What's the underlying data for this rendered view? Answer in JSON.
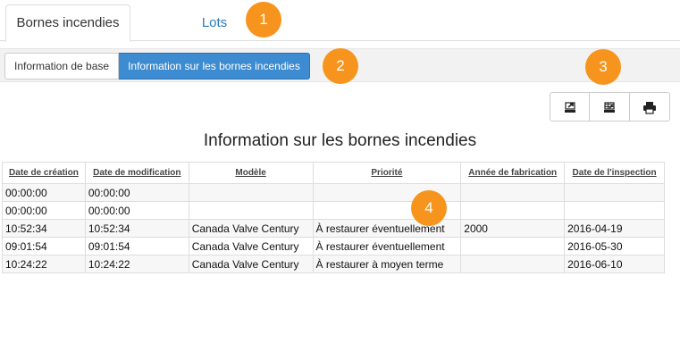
{
  "tabs": [
    {
      "label": "Bornes incendies",
      "active": true
    },
    {
      "label": "Lots",
      "active": false
    }
  ],
  "subtabs": [
    {
      "label": "Information de base",
      "active": false
    },
    {
      "label": "Information sur les bornes incendies",
      "active": true
    }
  ],
  "toolbar": {
    "buttons": [
      {
        "icon": "export-icon"
      },
      {
        "icon": "export-excel-icon"
      },
      {
        "icon": "print-icon"
      }
    ]
  },
  "title": "Information sur les bornes incendies",
  "table": {
    "columns": [
      "Date de création",
      "Date de modification",
      "Modèle",
      "Priorité",
      "Année de fabrication",
      "Date de l'inspection"
    ],
    "rows": [
      [
        "00:00:00",
        "00:00:00",
        "",
        "",
        "",
        ""
      ],
      [
        "00:00:00",
        "00:00:00",
        "",
        "",
        "",
        ""
      ],
      [
        "10:52:34",
        "10:52:34",
        "Canada Valve Century",
        "À restaurer éventuellement",
        "2000",
        "2016-04-19"
      ],
      [
        "09:01:54",
        "09:01:54",
        "Canada Valve Century",
        "À restaurer éventuellement",
        "",
        "2016-05-30"
      ],
      [
        "10:24:22",
        "10:24:22",
        "Canada Valve Century",
        "À restaurer à moyen terme",
        "",
        "2016-06-10"
      ]
    ]
  },
  "badges": [
    "1",
    "2",
    "3",
    "4"
  ],
  "colors": {
    "accent": "#3d8bd0",
    "badge": "#f7941d",
    "link": "#2a7ab8"
  }
}
